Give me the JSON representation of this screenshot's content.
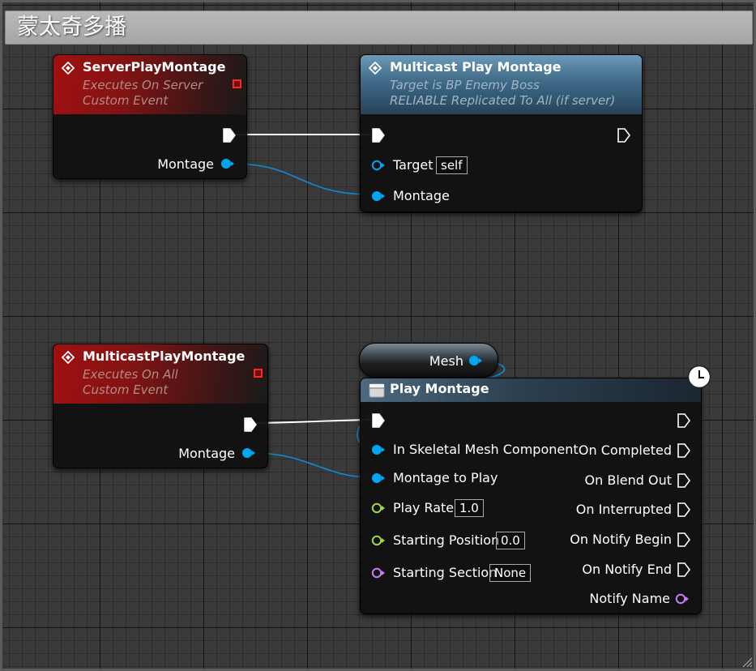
{
  "comment": {
    "title": "蒙太奇多播"
  },
  "colors": {
    "exec": "#ffffff",
    "object": "#00a8f4",
    "float": "#9cdc40",
    "name": "#c87dff",
    "event_header": "#a01010",
    "function_header": "#4c7a99"
  },
  "icons": {
    "event": "event-diamond-icon",
    "function": "function-diamond-icon",
    "latent": "latent-action-icon",
    "clock": "clock-icon",
    "delegate": "delegate-pin-icon"
  },
  "nodes": {
    "server_event": {
      "title": "ServerPlayMontage",
      "subtitle1": "Executes On Server",
      "subtitle2": "Custom Event",
      "montage_label": "Montage"
    },
    "multicast_call": {
      "title": "Multicast Play Montage",
      "subtitle1": "Target is BP Enemy Boss",
      "subtitle2": "RELIABLE Replicated To All (if server)",
      "target_label": "Target",
      "target_default": "self",
      "montage_label": "Montage"
    },
    "multicast_event": {
      "title": "MulticastPlayMontage",
      "subtitle1": "Executes On All",
      "subtitle2": "Custom Event",
      "montage_label": "Montage"
    },
    "mesh_var": {
      "label": "Mesh"
    },
    "play_montage": {
      "title": "Play Montage",
      "inputs": {
        "mesh": "In Skeletal Mesh Component",
        "montage": "Montage to Play",
        "rate": "Play Rate",
        "rate_value": "1.0",
        "position": "Starting Position",
        "position_value": "0.0",
        "section": "Starting Section",
        "section_value": "None"
      },
      "outputs": {
        "completed": "On Completed",
        "blend_out": "On Blend Out",
        "interrupted": "On Interrupted",
        "notify_begin": "On Notify Begin",
        "notify_end": "On Notify End",
        "notify_name": "Notify Name"
      }
    }
  }
}
